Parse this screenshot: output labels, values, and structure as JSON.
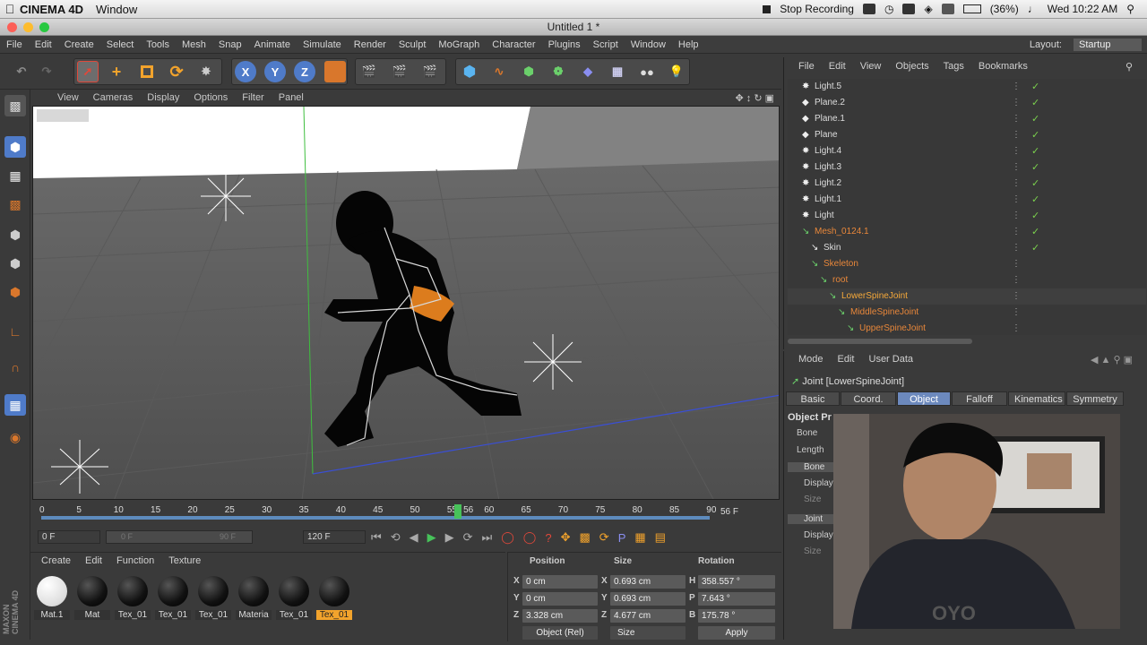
{
  "macbar": {
    "app": "CINEMA 4D",
    "menu": "Window",
    "stop_recording": "Stop Recording",
    "battery": "(36%)",
    "clock": "Wed 10:22 AM"
  },
  "window": {
    "title": "Untitled 1 *"
  },
  "app_menu": {
    "items": [
      "File",
      "Edit",
      "Create",
      "Select",
      "Tools",
      "Mesh",
      "Snap",
      "Animate",
      "Simulate",
      "Render",
      "Sculpt",
      "MoGraph",
      "Character",
      "Plugins",
      "Script",
      "Window",
      "Help"
    ],
    "layout_label": "Layout:",
    "layout_value": "Startup"
  },
  "viewport_menu": [
    "View",
    "Cameras",
    "Display",
    "Options",
    "Filter",
    "Panel"
  ],
  "toolbar": {
    "axes": [
      "X",
      "Y",
      "Z"
    ]
  },
  "timeline": {
    "ticks": [
      "0",
      "5",
      "10",
      "15",
      "20",
      "25",
      "30",
      "35",
      "40",
      "45",
      "50",
      "55",
      "56",
      "60",
      "65",
      "70",
      "75",
      "80",
      "85",
      "90"
    ],
    "current_frame": "56 F",
    "start_frame": "0 F",
    "range_start": "0 F",
    "range_end": "90 F",
    "end_frame": "120 F",
    "playhead_frame": 56,
    "max_frame": 90
  },
  "materials": {
    "menu": [
      "Create",
      "Edit",
      "Function",
      "Texture"
    ],
    "items": [
      "Mat.1",
      "Mat",
      "Tex_01",
      "Tex_01",
      "Tex_01",
      "Materia",
      "Tex_01",
      "Tex_01"
    ]
  },
  "coords": {
    "headers": [
      "Position",
      "Size",
      "Rotation"
    ],
    "rows": [
      {
        "axis": "X",
        "pos": "0 cm",
        "size_axis": "X",
        "size": "0.693 cm",
        "rot_axis": "H",
        "rot": "358.557 °"
      },
      {
        "axis": "Y",
        "pos": "0 cm",
        "size_axis": "Y",
        "size": "0.693 cm",
        "rot_axis": "P",
        "rot": "7.643 °"
      },
      {
        "axis": "Z",
        "pos": "3.328 cm",
        "size_axis": "Z",
        "size": "4.677 cm",
        "rot_axis": "B",
        "rot": "175.78 °"
      }
    ],
    "mode_select": "Object (Rel)",
    "size_select": "Size",
    "apply": "Apply"
  },
  "object_manager": {
    "menu": [
      "File",
      "Edit",
      "View",
      "Objects",
      "Tags",
      "Bookmarks"
    ],
    "rows": [
      {
        "name": "Light.5",
        "indent": 0,
        "color": "#dddddd",
        "check": "✓"
      },
      {
        "name": "Plane.2",
        "indent": 0,
        "color": "#dddddd",
        "check": "✓"
      },
      {
        "name": "Plane.1",
        "indent": 0,
        "color": "#dddddd",
        "check": "✓"
      },
      {
        "name": "Plane",
        "indent": 0,
        "color": "#dddddd",
        "check": "✓"
      },
      {
        "name": "Light.4",
        "indent": 0,
        "color": "#dddddd",
        "check": "✓"
      },
      {
        "name": "Light.3",
        "indent": 0,
        "color": "#dddddd",
        "check": "✓"
      },
      {
        "name": "Light.2",
        "indent": 0,
        "color": "#dddddd",
        "check": "✓"
      },
      {
        "name": "Light.1",
        "indent": 0,
        "color": "#dddddd",
        "check": "✓"
      },
      {
        "name": "Light",
        "indent": 0,
        "color": "#dddddd",
        "check": "✓"
      },
      {
        "name": "Mesh_0124.1",
        "indent": 0,
        "color": "#e8873a",
        "check": "✓"
      },
      {
        "name": "Skin",
        "indent": 1,
        "color": "#dddddd",
        "check": "✓"
      },
      {
        "name": "Skeleton",
        "indent": 1,
        "color": "#e8873a",
        "check": ""
      },
      {
        "name": "root",
        "indent": 2,
        "color": "#e8873a",
        "check": ""
      },
      {
        "name": "LowerSpineJoint",
        "indent": 3,
        "color": "#f4a83a",
        "check": ""
      },
      {
        "name": "MiddleSpineJoint",
        "indent": 4,
        "color": "#e8873a",
        "check": ""
      },
      {
        "name": "UpperSpineJoint",
        "indent": 5,
        "color": "#e8873a",
        "check": ""
      }
    ]
  },
  "attribute_manager": {
    "menu": [
      "Mode",
      "Edit",
      "User Data"
    ],
    "title": "Joint [LowerSpineJoint]",
    "tabs": [
      "Basic",
      "Coord.",
      "Object",
      "Falloff",
      "Kinematics",
      "Symmetry"
    ],
    "active_tab": "Object",
    "section": "Object Pr",
    "fields": [
      "Bone",
      "Length",
      "Bone",
      "Display",
      "Size",
      "Joint",
      "Display",
      "Size"
    ]
  },
  "colors": {
    "accent": "#6c89bd",
    "orange": "#e8873a",
    "check": "#7ad04d"
  }
}
